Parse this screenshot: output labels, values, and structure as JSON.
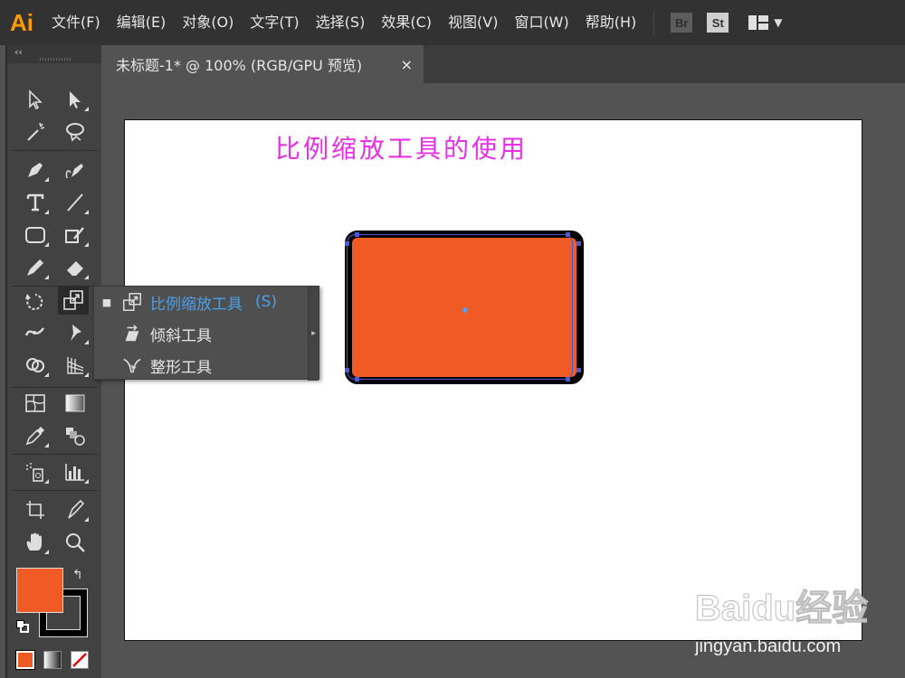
{
  "app": {
    "logo": "Ai"
  },
  "menubar": {
    "items": [
      "文件(F)",
      "编辑(E)",
      "对象(O)",
      "文字(T)",
      "选择(S)",
      "效果(C)",
      "视图(V)",
      "窗口(W)",
      "帮助(H)"
    ],
    "badges": [
      "Br",
      "St"
    ],
    "workspace_caret": "▼"
  },
  "toolbar": {
    "collapse": "‹‹",
    "swap": "↰"
  },
  "document": {
    "tab_label": "未标题-1* @ 100% (RGB/GPU 预览)",
    "close": "×"
  },
  "artboard": {
    "title": "比例缩放工具的使用",
    "shape_fill": "#F05A24",
    "shape_stroke": "#000000",
    "selection_color": "#4a5bd6"
  },
  "flyout": {
    "items": [
      {
        "label": "比例缩放工具",
        "shortcut": "(S)",
        "selected": true,
        "bullet": "■"
      },
      {
        "label": "倾斜工具",
        "shortcut": "",
        "selected": false,
        "bullet": ""
      },
      {
        "label": "整形工具",
        "shortcut": "",
        "selected": false,
        "bullet": ""
      }
    ],
    "arrow": "▸"
  },
  "colors": {
    "fill": "#F05A24",
    "stroke": "#000000",
    "accent": "#4a9fe8",
    "title": "#E62FE6"
  },
  "watermark": {
    "logo": "Baidu经验",
    "url": "jingyan.baidu.com"
  }
}
